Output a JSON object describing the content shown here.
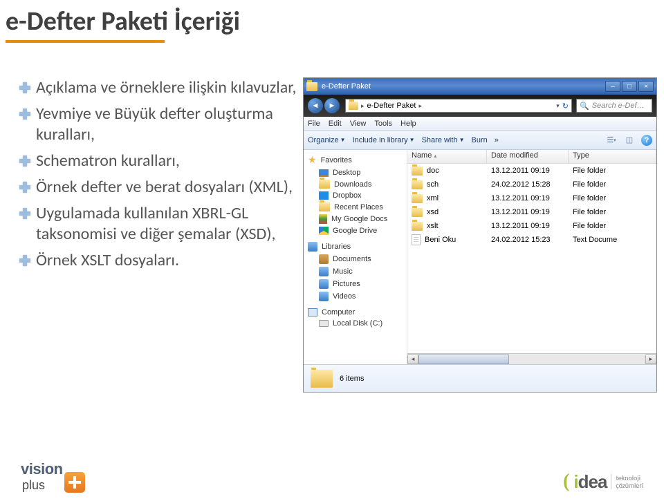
{
  "slide": {
    "title": "e-Defter Paketi İçeriği",
    "bullets": [
      "Açıklama ve örneklere ilişkin kılavuzlar,",
      "Yevmiye ve Büyük defter oluşturma kuralları,",
      "Schematron kuralları,",
      "Örnek defter ve berat dosyaları (XML),",
      "Uygulamada kullanılan XBRL-GL taksonomisi ve diğer şemalar (XSD),",
      "Örnek XSLT dosyaları."
    ]
  },
  "explorer": {
    "window_title": "e-Defter Paket",
    "breadcrumb": "e-Defter Paket",
    "search_placeholder": "Search e-Def…",
    "menu": [
      "File",
      "Edit",
      "View",
      "Tools",
      "Help"
    ],
    "toolbar": {
      "organize": "Organize",
      "include": "Include in library",
      "share": "Share with",
      "burn": "Burn",
      "more": "»"
    },
    "sidebar": {
      "favorites": {
        "label": "Favorites",
        "items": [
          "Desktop",
          "Downloads",
          "Dropbox",
          "Recent Places",
          "My Google Docs",
          "Google Drive"
        ]
      },
      "libraries": {
        "label": "Libraries",
        "items": [
          "Documents",
          "Music",
          "Pictures",
          "Videos"
        ]
      },
      "computer": {
        "label": "Computer",
        "items": [
          "Local Disk (C:)"
        ]
      }
    },
    "columns": {
      "name": "Name",
      "date": "Date modified",
      "type": "Type"
    },
    "files": [
      {
        "name": "doc",
        "date": "13.12.2011 09:19",
        "type": "File folder",
        "kind": "folder"
      },
      {
        "name": "sch",
        "date": "24.02.2012 15:28",
        "type": "File folder",
        "kind": "folder"
      },
      {
        "name": "xml",
        "date": "13.12.2011 09:19",
        "type": "File folder",
        "kind": "folder"
      },
      {
        "name": "xsd",
        "date": "13.12.2011 09:19",
        "type": "File folder",
        "kind": "folder"
      },
      {
        "name": "xslt",
        "date": "13.12.2011 09:19",
        "type": "File folder",
        "kind": "folder"
      },
      {
        "name": "Beni Oku",
        "date": "24.02.2012 15:23",
        "type": "Text Docume",
        "kind": "file"
      }
    ],
    "status": "6 items"
  },
  "footer": {
    "vision_brand": "vision",
    "vision_sub": "plus",
    "idea_brand_i": "i",
    "idea_brand_rest": "dea",
    "idea_tag1": "teknoloji",
    "idea_tag2": "çözümleri"
  }
}
